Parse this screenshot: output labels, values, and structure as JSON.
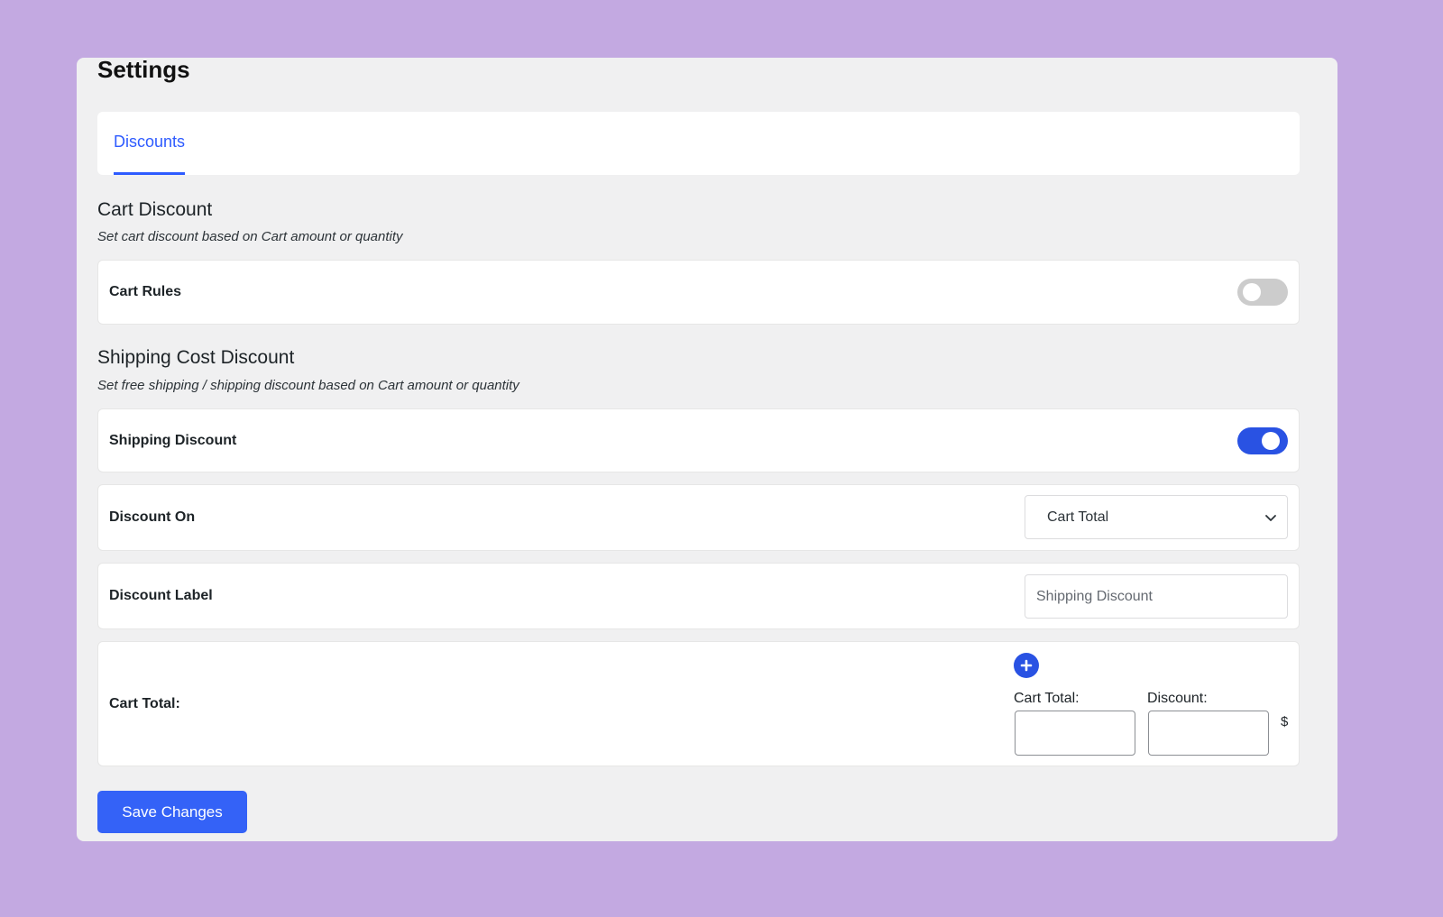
{
  "page": {
    "title": "Settings"
  },
  "tabs": [
    {
      "label": "Discounts",
      "active": true
    }
  ],
  "cart_discount": {
    "title": "Cart Discount",
    "description": "Set cart discount based on Cart amount or quantity",
    "cart_rules": {
      "label": "Cart Rules",
      "enabled": false
    }
  },
  "shipping_discount": {
    "title": "Shipping Cost Discount",
    "description": "Set free shipping / shipping discount based on Cart amount or quantity",
    "toggle": {
      "label": "Shipping Discount",
      "enabled": true
    },
    "discount_on": {
      "label": "Discount On",
      "selected": "Cart Total"
    },
    "discount_label": {
      "label": "Discount Label",
      "value": "",
      "placeholder": "Shipping Discount"
    },
    "cart_total_rules": {
      "label": "Cart Total:",
      "add_icon": "plus-circle-icon",
      "cart_total_field_label": "Cart Total:",
      "cart_total_value": "",
      "discount_field_label": "Discount:",
      "discount_value": "",
      "currency_symbol": "$"
    }
  },
  "actions": {
    "save_label": "Save Changes"
  },
  "colors": {
    "background": "#c3a9e1",
    "panel": "#f0f0f1",
    "accent": "#2952e3",
    "button": "#3462f7",
    "toggle_off": "#cccccc"
  }
}
